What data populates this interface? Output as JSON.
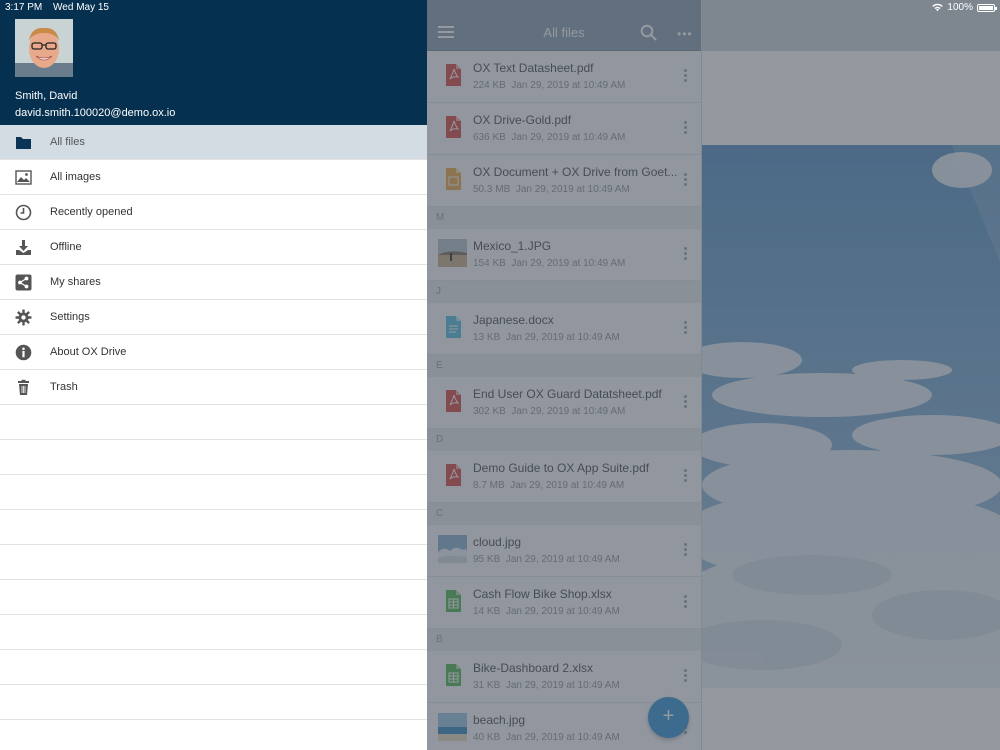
{
  "status_bar": {
    "time": "3:17 PM",
    "date": "Wed May 15",
    "battery": "100%",
    "wifi_icon": "wifi-icon",
    "battery_icon": "battery-icon"
  },
  "profile": {
    "name": "Smith, David",
    "email": "david.smith.100020@demo.ox.io"
  },
  "menu": {
    "items": [
      {
        "label": "All files",
        "icon": "folder-icon",
        "active": true
      },
      {
        "label": "All images",
        "icon": "image-icon"
      },
      {
        "label": "Recently opened",
        "icon": "clock-icon"
      },
      {
        "label": "Offline",
        "icon": "download-icon"
      },
      {
        "label": "My shares",
        "icon": "share-icon"
      },
      {
        "label": "Settings",
        "icon": "gear-icon"
      },
      {
        "label": "About OX Drive",
        "icon": "info-icon"
      },
      {
        "label": "Trash",
        "icon": "trash-icon"
      }
    ]
  },
  "files_panel": {
    "title": "All files",
    "menu_icon": "hamburger-icon",
    "search_icon": "search-icon",
    "more_icon": "more-icon",
    "fab_label": "+",
    "sections": [
      {
        "header": "",
        "files": [
          {
            "name": "OX Text Datasheet.pdf",
            "size": "224 KB",
            "date": "Jan 29, 2019 at 10:49 AM",
            "type": "pdf"
          },
          {
            "name": "OX Drive-Gold.pdf",
            "size": "636 KB",
            "date": "Jan 29, 2019 at 10:49 AM",
            "type": "pdf"
          },
          {
            "name": "OX Document + OX Drive from Goet...",
            "size": "50.3 MB",
            "date": "Jan 29, 2019 at 10:49 AM",
            "type": "doc-orange"
          }
        ]
      },
      {
        "header": "M",
        "files": [
          {
            "name": "Mexico_1.JPG",
            "size": "154 KB",
            "date": "Jan 29, 2019 at 10:49 AM",
            "type": "image"
          }
        ]
      },
      {
        "header": "J",
        "files": [
          {
            "name": "Japanese.docx",
            "size": "13 KB",
            "date": "Jan 29, 2019 at 10:49 AM",
            "type": "docx"
          }
        ]
      },
      {
        "header": "E",
        "files": [
          {
            "name": "End User OX Guard Datatsheet.pdf",
            "size": "302 KB",
            "date": "Jan 29, 2019 at 10:49 AM",
            "type": "pdf"
          }
        ]
      },
      {
        "header": "D",
        "files": [
          {
            "name": "Demo Guide to OX App Suite.pdf",
            "size": "8.7 MB",
            "date": "Jan 29, 2019 at 10:49 AM",
            "type": "pdf"
          }
        ]
      },
      {
        "header": "C",
        "files": [
          {
            "name": "cloud.jpg",
            "size": "95 KB",
            "date": "Jan 29, 2019 at 10:49 AM",
            "type": "image"
          },
          {
            "name": "Cash Flow Bike Shop.xlsx",
            "size": "14 KB",
            "date": "Jan 29, 2019 at 10:49 AM",
            "type": "xlsx"
          }
        ]
      },
      {
        "header": "B",
        "files": [
          {
            "name": "Bike-Dashboard 2.xlsx",
            "size": "31 KB",
            "date": "Jan 29, 2019 at 10:49 AM",
            "type": "xlsx"
          },
          {
            "name": "beach.jpg",
            "size": "40 KB",
            "date": "Jan 29, 2019 at 10:49 AM",
            "type": "image"
          }
        ]
      }
    ]
  },
  "colors": {
    "header_bg": "#06304f",
    "active_item_bg": "#d3dbe3",
    "fab": "#3c99d4",
    "pdf": "#d9534f",
    "xlsx": "#5cb85c",
    "docx": "#5bc0de",
    "doc_orange": "#f0ad4e"
  }
}
